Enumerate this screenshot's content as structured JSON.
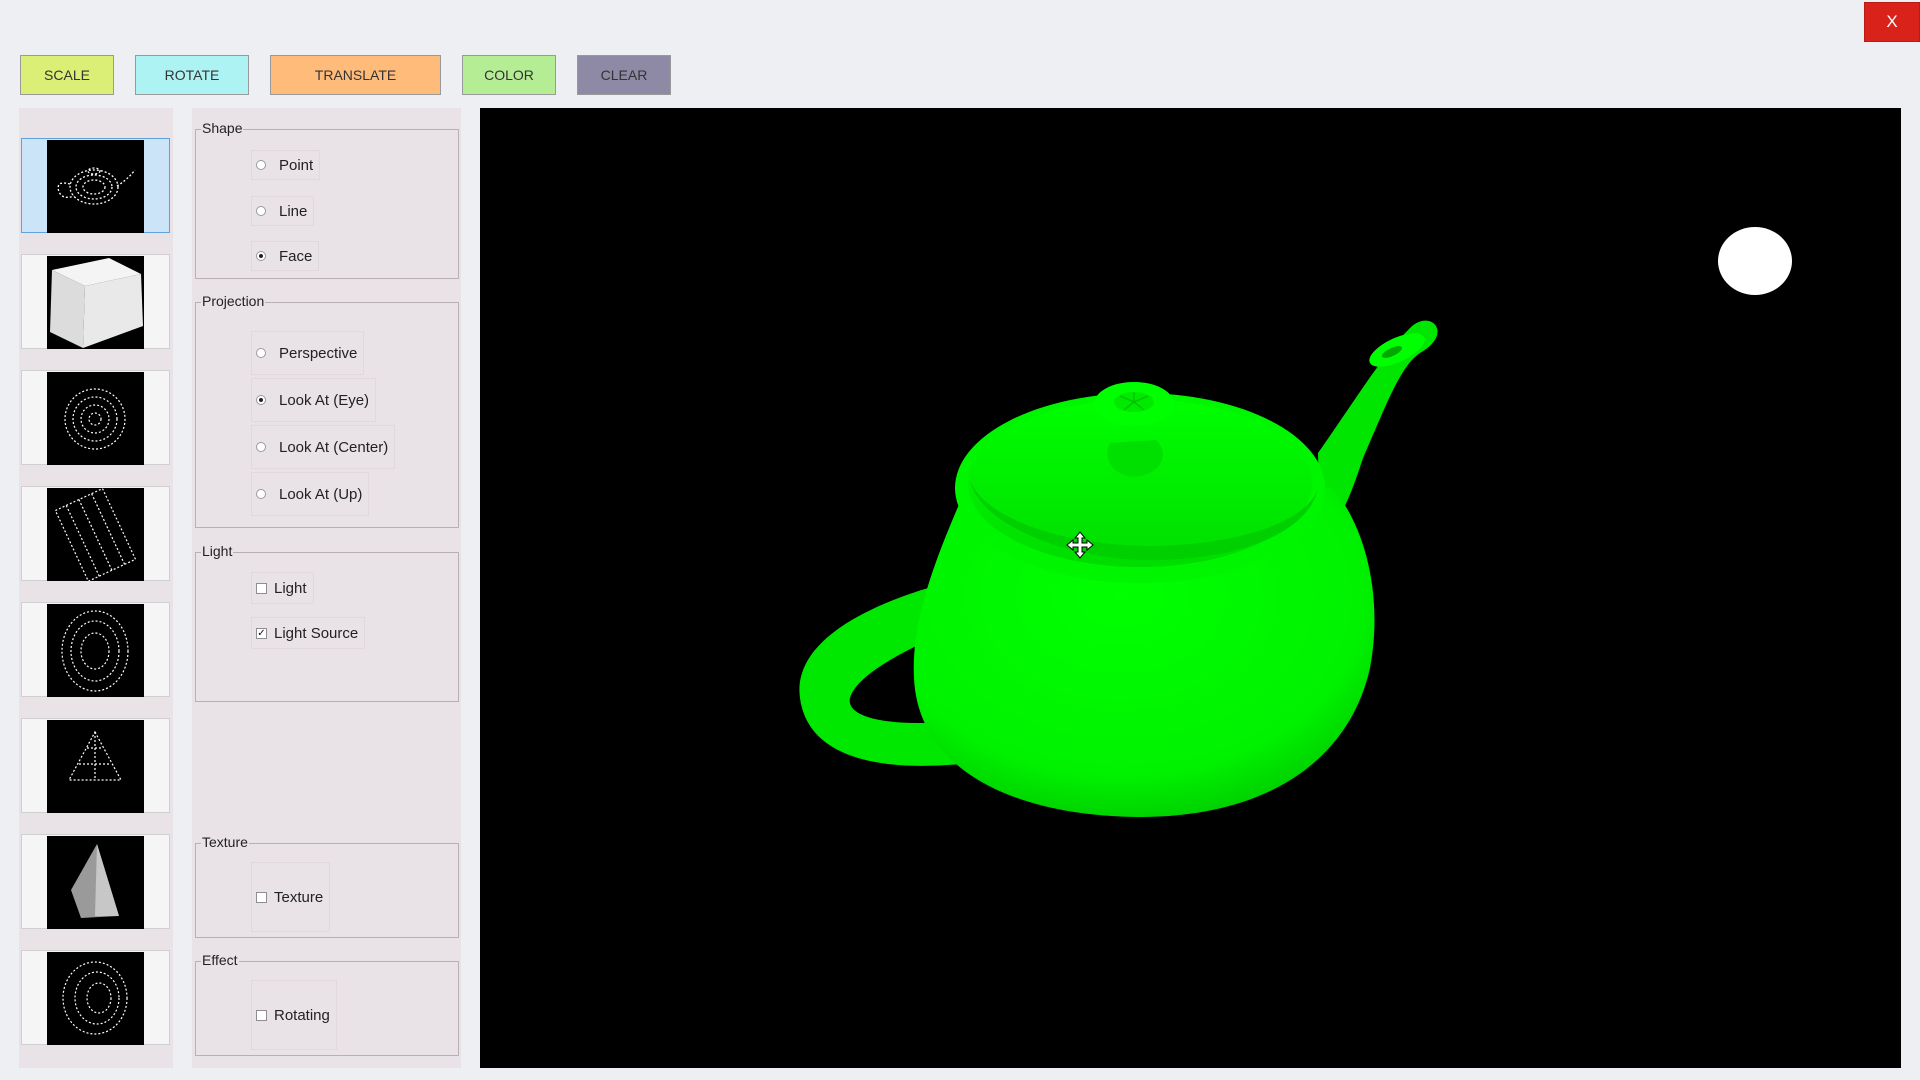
{
  "window": {
    "close_label": "X",
    "close_color": "#d9231a"
  },
  "toolbar": [
    {
      "name": "scale-button",
      "label": "SCALE",
      "color": "#dbef77"
    },
    {
      "name": "rotate-button",
      "label": "ROTATE",
      "color": "#adf3f3"
    },
    {
      "name": "translate-button",
      "label": "TRANSLATE",
      "color": "#ffbb7a"
    },
    {
      "name": "color-button",
      "label": "COLOR",
      "color": "#b4ed94"
    },
    {
      "name": "clear-button",
      "label": "CLEAR",
      "color": "#8e8aa6"
    }
  ],
  "models": [
    {
      "name": "teapot",
      "icon": "teapot-points-icon",
      "selected": true
    },
    {
      "name": "cube",
      "icon": "cube-icon",
      "selected": false
    },
    {
      "name": "sphere",
      "icon": "sphere-points-icon",
      "selected": false
    },
    {
      "name": "cylinder",
      "icon": "cylinder-points-icon",
      "selected": false
    },
    {
      "name": "torus",
      "icon": "torus-points-icon",
      "selected": false
    },
    {
      "name": "cone",
      "icon": "cone-points-icon",
      "selected": false
    },
    {
      "name": "pyramid",
      "icon": "pyramid-icon",
      "selected": false
    },
    {
      "name": "donut",
      "icon": "donut-points-icon",
      "selected": false
    }
  ],
  "groups": {
    "shape": {
      "title": "Shape",
      "options": [
        {
          "label": "Point",
          "checked": false
        },
        {
          "label": "Line",
          "checked": false
        },
        {
          "label": "Face",
          "checked": true
        }
      ]
    },
    "projection": {
      "title": "Projection",
      "options": [
        {
          "label": "Perspective",
          "checked": false
        },
        {
          "label": "Look At (Eye)",
          "checked": true
        },
        {
          "label": "Look At (Center)",
          "checked": false
        },
        {
          "label": "Look At (Up)",
          "checked": false
        }
      ]
    },
    "light": {
      "title": "Light",
      "options": [
        {
          "label": "Light",
          "checked": false
        },
        {
          "label": "Light Source",
          "checked": true
        }
      ]
    },
    "texture": {
      "title": "Texture",
      "options": [
        {
          "label": "Texture",
          "checked": false
        }
      ]
    },
    "effect": {
      "title": "Effect",
      "options": [
        {
          "label": "Rotating",
          "checked": false
        }
      ]
    }
  },
  "scene": {
    "background": "#000000",
    "model": "teapot",
    "model_color": "#00ff00",
    "light_source_color": "#ffffff",
    "cursor_icon": "move-cursor-icon"
  }
}
